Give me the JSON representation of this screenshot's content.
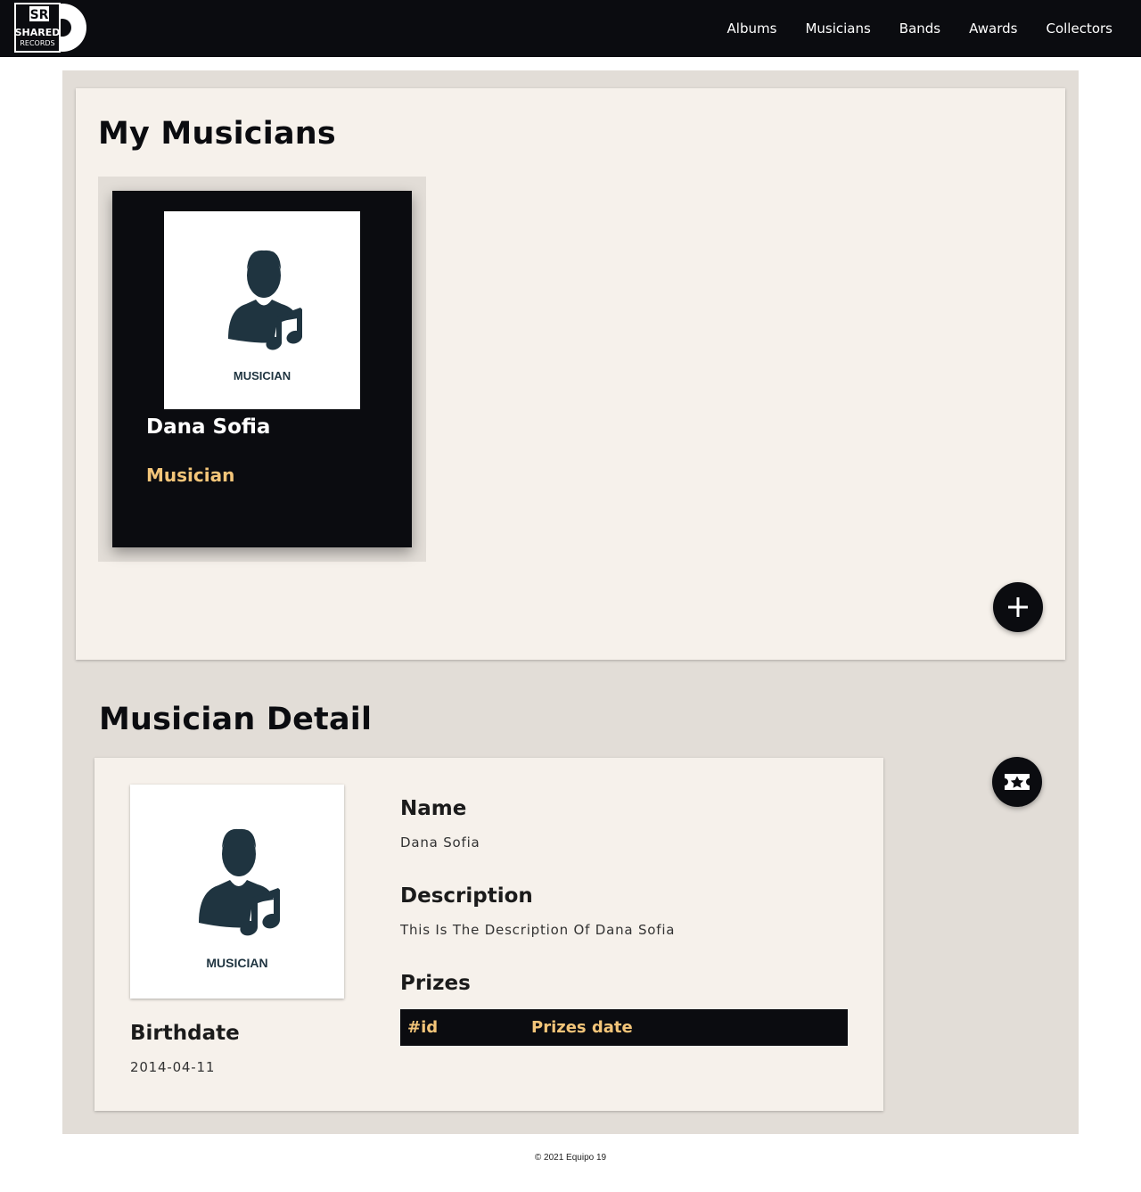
{
  "header": {
    "logo": {
      "line1": "SR",
      "line2": "SHARED",
      "line3": "RECORDS"
    },
    "nav": [
      {
        "label": "Albums"
      },
      {
        "label": "Musicians"
      },
      {
        "label": "Bands"
      },
      {
        "label": "Awards"
      },
      {
        "label": "Collectors"
      }
    ]
  },
  "musicians_section": {
    "title": "My Musicians",
    "items": [
      {
        "name": "Dana Sofia",
        "role": "Musician",
        "image_caption": "MUSICIAN",
        "icon": "musician-icon"
      }
    ],
    "add_button_icon": "plus-icon"
  },
  "detail": {
    "title": "Musician Detail",
    "image_caption": "MUSICIAN",
    "birthdate_label": "Birthdate",
    "birthdate_value": "2014-04-11",
    "name_label": "Name",
    "name_value": "Dana Sofia",
    "description_label": "Description",
    "description_value": "This Is The Description Of Dana Sofia",
    "prizes_label": "Prizes",
    "prizes_table": {
      "columns": [
        "#id",
        "Prizes date"
      ],
      "rows": []
    },
    "award_button_icon": "ticket-star-icon"
  },
  "footer": {
    "text": "© 2021 Equipo 19"
  },
  "colors": {
    "dark": "#0b0c10",
    "accent": "#f3c579",
    "panel": "#f6f1eb",
    "background": "#e2ddd7"
  }
}
